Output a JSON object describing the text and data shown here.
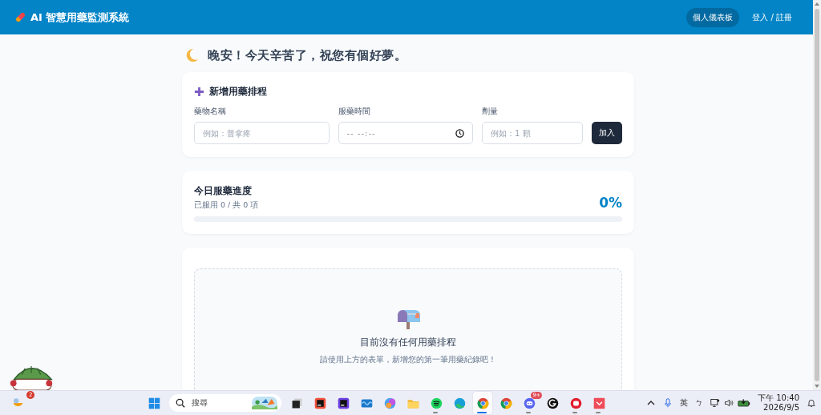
{
  "header": {
    "title": "AI 智慧用藥監測系統",
    "nav": [
      {
        "label": "個人儀表板",
        "selected": true
      },
      {
        "label": "登入 / 註冊",
        "selected": false
      }
    ]
  },
  "greeting": "晚安！今天辛苦了，祝您有個好夢。",
  "add_form": {
    "title": "新增用藥排程",
    "fields": [
      {
        "kind": "text",
        "label": "藥物名稱",
        "placeholder": "例如：普拿疼"
      },
      {
        "kind": "time",
        "label": "服藥時間",
        "placeholder": "-- --:--"
      },
      {
        "kind": "text",
        "label": "劑量",
        "placeholder": "例如：1 顆"
      }
    ],
    "submit": "加入"
  },
  "progress": {
    "title": "今日服藥進度",
    "summary": "已服用 0 / 共 0 項",
    "percent": "0%",
    "level": 0
  },
  "empty_state": {
    "title": "目前沒有任何用藥排程",
    "hint": "請使用上方的表單，新增您的第一筆用藥紀錄吧！"
  },
  "taskbar": {
    "weather_badge": "2",
    "search_placeholder": "搜尋",
    "apps": [
      {
        "kind": "start",
        "running": false,
        "selected": false
      },
      {
        "kind": "taskview",
        "running": false,
        "selected": false
      },
      {
        "kind": "ide",
        "running": false,
        "selected": false
      },
      {
        "kind": "ide2",
        "running": false,
        "selected": false
      },
      {
        "kind": "wave",
        "running": false,
        "selected": false
      },
      {
        "kind": "copilot",
        "running": false,
        "selected": false
      },
      {
        "kind": "folder",
        "running": false,
        "selected": false
      },
      {
        "kind": "spotify",
        "running": true,
        "selected": false
      },
      {
        "kind": "edge",
        "running": false,
        "selected": false
      },
      {
        "kind": "chrome",
        "running": true,
        "selected": true
      },
      {
        "kind": "chrome",
        "running": false,
        "selected": false
      },
      {
        "kind": "discord",
        "running": true,
        "selected": false,
        "badge": "9+"
      },
      {
        "kind": "g",
        "running": false,
        "selected": false
      },
      {
        "kind": "red",
        "running": true,
        "selected": false
      },
      {
        "kind": "pink",
        "running": true,
        "selected": false
      }
    ],
    "ime": "英",
    "ime_mode": "ㄅ",
    "time": "下午 10:40",
    "date": "2026/9/5"
  }
}
